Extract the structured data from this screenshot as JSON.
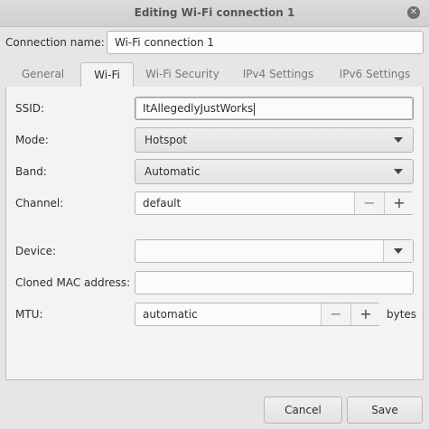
{
  "window": {
    "title": "Editing Wi-Fi connection 1"
  },
  "connection_name": {
    "label": "Connection name:",
    "value": "Wi-Fi connection 1"
  },
  "tabs": [
    {
      "label": "General",
      "active": false
    },
    {
      "label": "Wi-Fi",
      "active": true
    },
    {
      "label": "Wi-Fi Security",
      "active": false
    },
    {
      "label": "IPv4 Settings",
      "active": false
    },
    {
      "label": "IPv6 Settings",
      "active": false
    }
  ],
  "wifi": {
    "ssid": {
      "label": "SSID:",
      "value": "ItAllegedlyJustWorks"
    },
    "mode": {
      "label": "Mode:",
      "value": "Hotspot"
    },
    "band": {
      "label": "Band:",
      "value": "Automatic"
    },
    "channel": {
      "label": "Channel:",
      "value": "default",
      "minus": "−",
      "plus": "+"
    },
    "device": {
      "label": "Device:",
      "value": ""
    },
    "cloned_mac": {
      "label": "Cloned MAC address:",
      "value": ""
    },
    "mtu": {
      "label": "MTU:",
      "value": "automatic",
      "minus": "−",
      "plus": "+",
      "unit": "bytes"
    }
  },
  "buttons": {
    "cancel": "Cancel",
    "save": "Save"
  },
  "icons": {
    "close": "close-icon",
    "dropdown": "chevron-down-icon"
  }
}
